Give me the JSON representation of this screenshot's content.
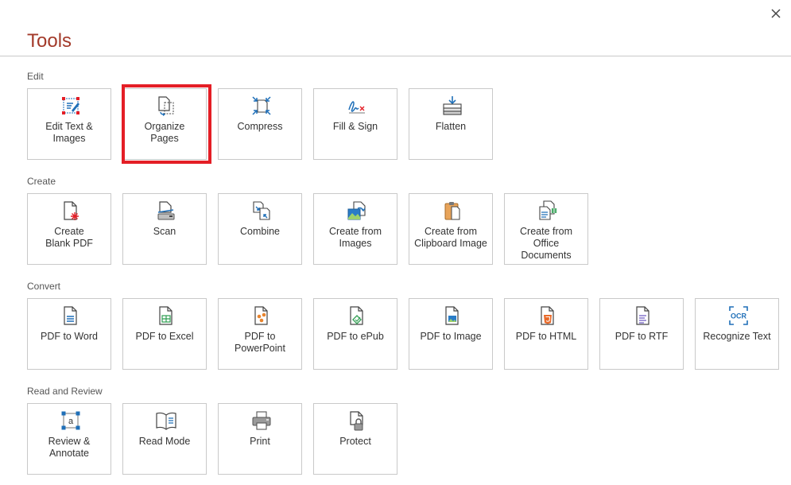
{
  "dialog": {
    "title": "Tools"
  },
  "sections": {
    "edit": {
      "label": "Edit",
      "tiles": [
        {
          "label": "Edit Text &\nImages",
          "icon": "edit-text-images-icon"
        },
        {
          "label": "Organize\nPages",
          "icon": "organize-pages-icon"
        },
        {
          "label": "Compress",
          "icon": "compress-icon"
        },
        {
          "label": "Fill & Sign",
          "icon": "fill-sign-icon"
        },
        {
          "label": "Flatten",
          "icon": "flatten-icon"
        }
      ]
    },
    "create": {
      "label": "Create",
      "tiles": [
        {
          "label": "Create\nBlank PDF",
          "icon": "blank-pdf-icon"
        },
        {
          "label": "Scan",
          "icon": "scan-icon"
        },
        {
          "label": "Combine",
          "icon": "combine-icon"
        },
        {
          "label": "Create from\nImages",
          "icon": "images-icon"
        },
        {
          "label": "Create from\nClipboard Image",
          "icon": "clipboard-icon"
        },
        {
          "label": "Create from\nOffice\nDocuments",
          "icon": "office-documents-icon"
        }
      ]
    },
    "convert": {
      "label": "Convert",
      "tiles": [
        {
          "label": "PDF to Word",
          "icon": "word-icon"
        },
        {
          "label": "PDF to Excel",
          "icon": "excel-icon"
        },
        {
          "label": "PDF to\nPowerPoint",
          "icon": "powerpoint-icon"
        },
        {
          "label": "PDF to ePub",
          "icon": "epub-icon"
        },
        {
          "label": "PDF to Image",
          "icon": "image-icon"
        },
        {
          "label": "PDF to HTML",
          "icon": "html-icon"
        },
        {
          "label": "PDF to RTF",
          "icon": "rtf-icon"
        },
        {
          "label": "Recognize Text",
          "icon": "ocr-icon",
          "icon_text": "OCR"
        }
      ]
    },
    "review": {
      "label": "Read and Review",
      "tiles": [
        {
          "label": "Review &\nAnnotate",
          "icon": "review-annotate-icon",
          "icon_text": "a"
        },
        {
          "label": "Read Mode",
          "icon": "read-mode-icon"
        },
        {
          "label": "Print",
          "icon": "printer-icon"
        },
        {
          "label": "Protect",
          "icon": "lock-icon"
        }
      ]
    }
  },
  "colors": {
    "title": "#a33a2a",
    "accent_blue": "#1f6fb8",
    "highlight": "#e41e26"
  }
}
